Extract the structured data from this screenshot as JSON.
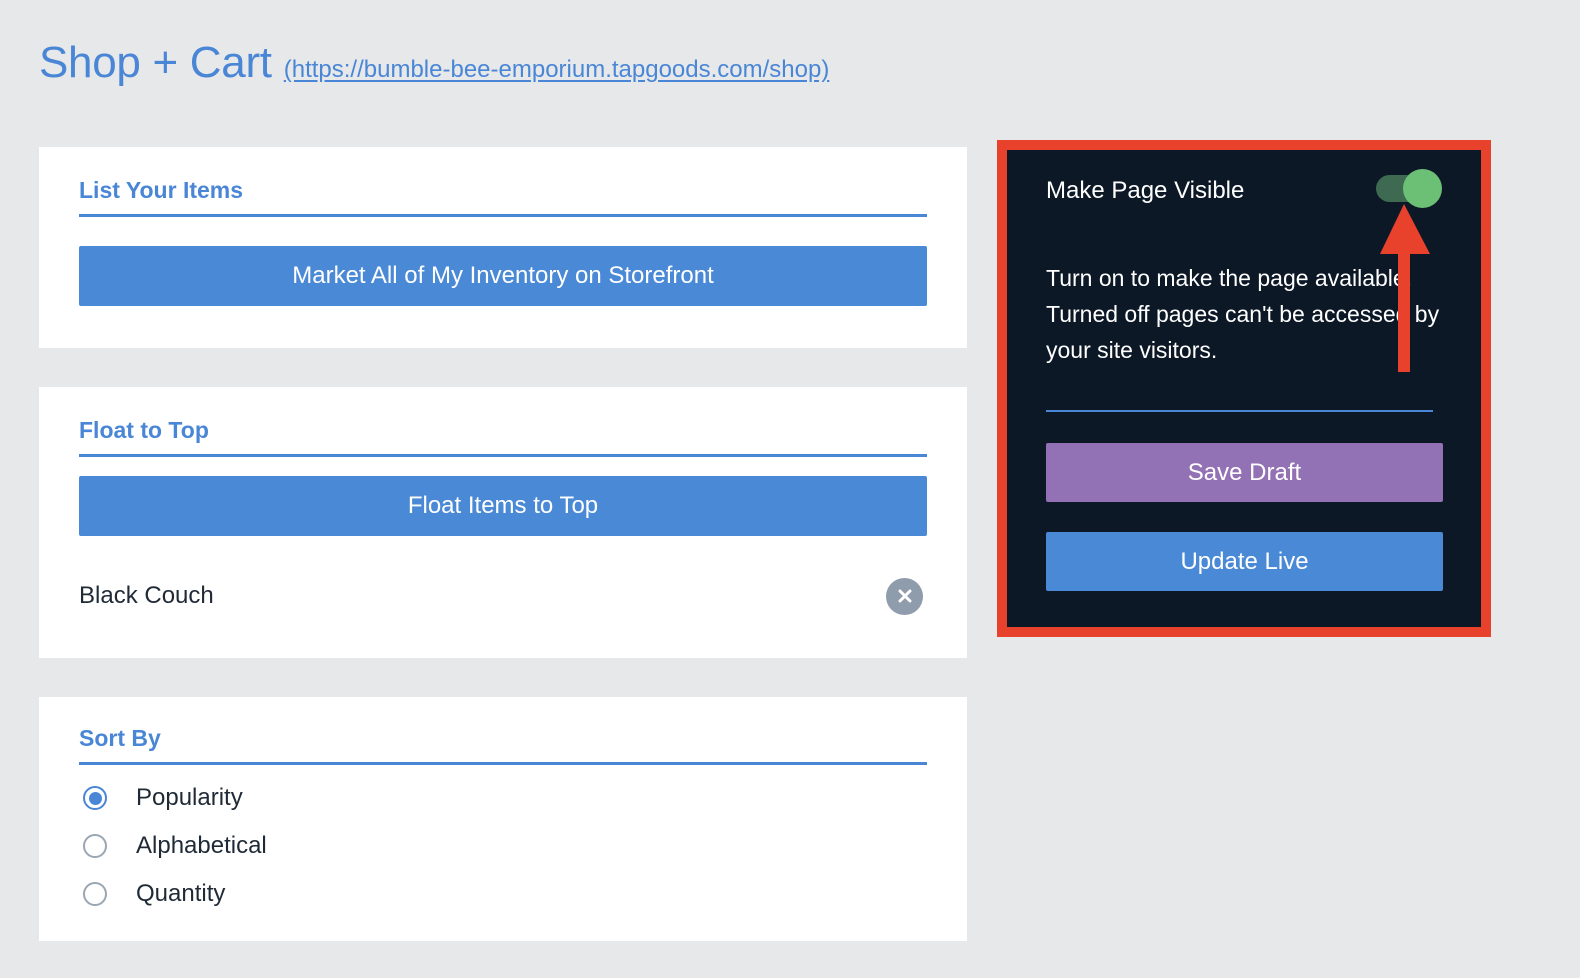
{
  "header": {
    "title": "Shop + Cart",
    "url": "(https://bumble-bee-emporium.tapgoods.com/shop)"
  },
  "list_items": {
    "heading": "List Your Items",
    "button_label": "Market All of My Inventory on Storefront"
  },
  "float_to_top": {
    "heading": "Float to Top",
    "button_label": "Float Items to Top",
    "items": [
      "Black Couch"
    ]
  },
  "sort_by": {
    "heading": "Sort By",
    "options": [
      "Popularity",
      "Alphabetical",
      "Quantity"
    ],
    "selected": "Popularity"
  },
  "visibility_panel": {
    "toggle_label": "Make Page Visible",
    "toggle_on": true,
    "description": "Turn on to make the page available. Turned off pages can't be accessed by your site visitors.",
    "save_draft_label": "Save Draft",
    "update_live_label": "Update Live"
  },
  "colors": {
    "accent": "#4a86d6",
    "page_background": "#e7e8ea",
    "panel_background": "#0c1826",
    "highlight_border": "#e8412c",
    "save_draft": "#9271b5",
    "toggle_knob": "#6cc076"
  },
  "icons": {
    "remove": "close-icon",
    "annotation": "arrow-up-icon"
  }
}
